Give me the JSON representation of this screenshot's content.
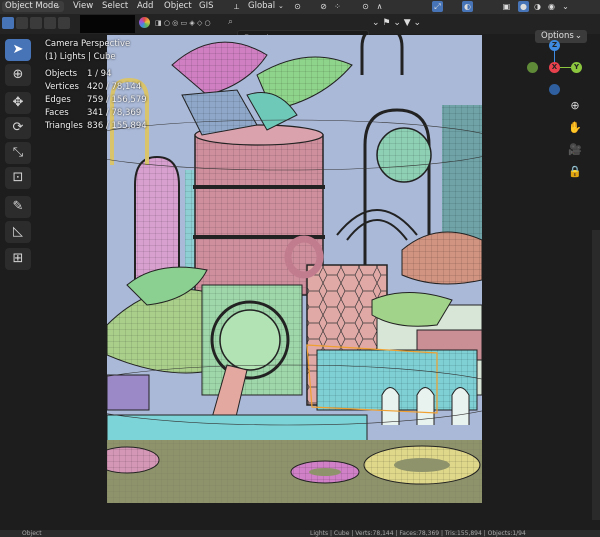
{
  "header": {
    "mode": "Object Mode",
    "menu": [
      "View",
      "Select",
      "Add",
      "Object",
      "GIS"
    ],
    "orientation": "Global"
  },
  "subbar": {
    "search_placeholder": "Search",
    "options_label": "Options"
  },
  "overlay": {
    "view_name": "Camera Perspective",
    "collection": "(1) Lights | Cube",
    "stats": [
      {
        "label": "Objects",
        "value": "1 / 94"
      },
      {
        "label": "Vertices",
        "value": "420 / 78,144"
      },
      {
        "label": "Edges",
        "value": "759 / 156,579"
      },
      {
        "label": "Faces",
        "value": "341 / 78,369"
      },
      {
        "label": "Triangles",
        "value": "836 / 155,894"
      }
    ]
  },
  "gizmo": {
    "z": "Z",
    "x": "X",
    "y": "Y"
  },
  "toolbar": {
    "tools": [
      "select-box",
      "cursor",
      "move",
      "rotate",
      "scale",
      "transform",
      "annotate",
      "measure",
      "add-cube"
    ],
    "active": "select-box"
  },
  "statusbar": {
    "left": "Object",
    "right": "Lights | Cube | Verts:78,144 | Faces:78,369 | Tris:155,894 | Objects:1/94"
  },
  "colors": {
    "accent": "#4774b7",
    "gizmo_x": "#e8414e",
    "gizmo_y": "#8cc63f",
    "gizmo_z": "#3d8ae0"
  }
}
